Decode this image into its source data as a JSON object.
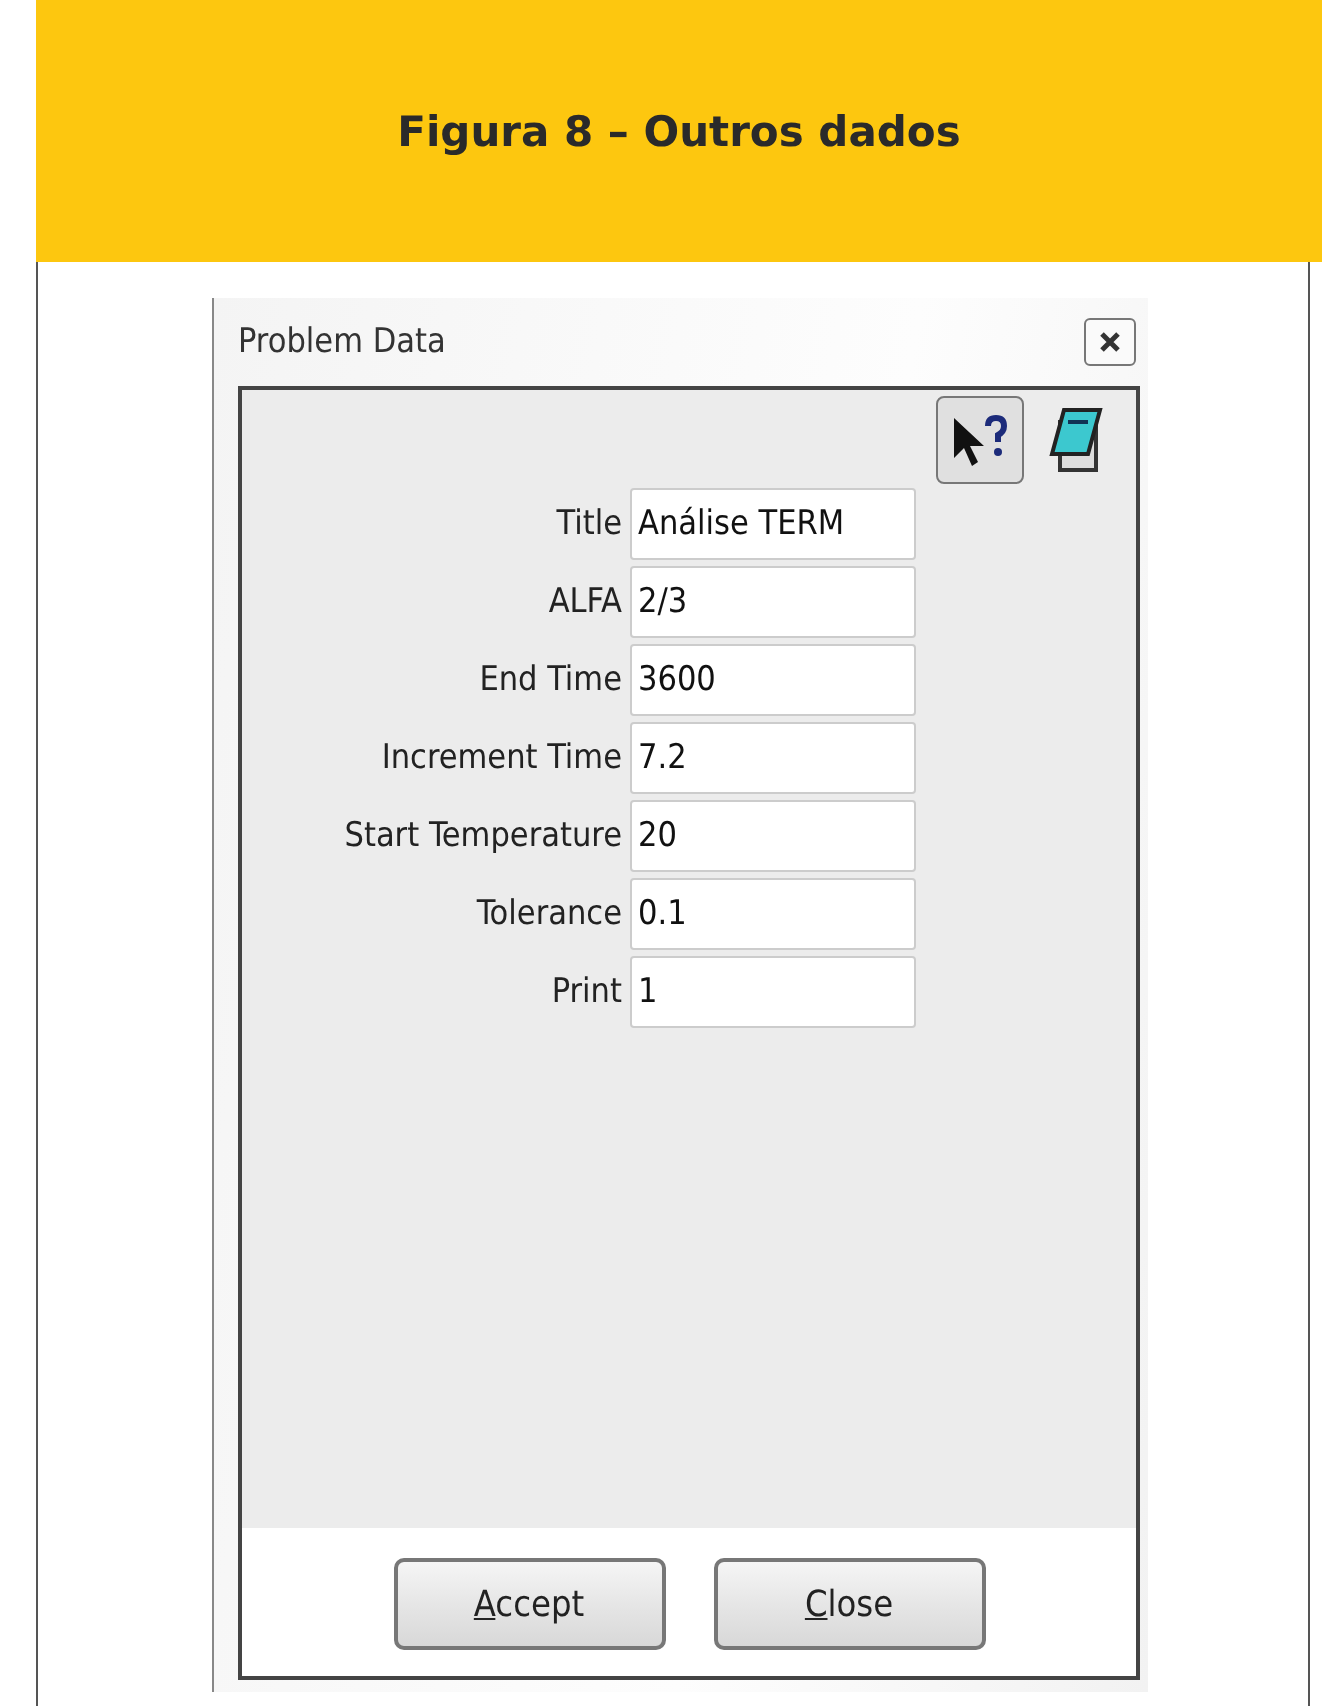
{
  "figure": {
    "caption": "Figura 8 – Outros dados"
  },
  "window": {
    "title": "Problem Data"
  },
  "fields": [
    {
      "label": "Title",
      "value": "Análise TERM"
    },
    {
      "label": "ALFA",
      "value": "2/3"
    },
    {
      "label": "End Time",
      "value": "3600"
    },
    {
      "label": "Increment Time",
      "value": "7.2"
    },
    {
      "label": "Start Temperature",
      "value": "20"
    },
    {
      "label": "Tolerance",
      "value": "0.1"
    },
    {
      "label": "Print",
      "value": "1"
    }
  ],
  "buttons": [
    {
      "label": "Accept",
      "mnemonic_first": true
    },
    {
      "label": "Close",
      "mnemonic_first": true
    }
  ]
}
